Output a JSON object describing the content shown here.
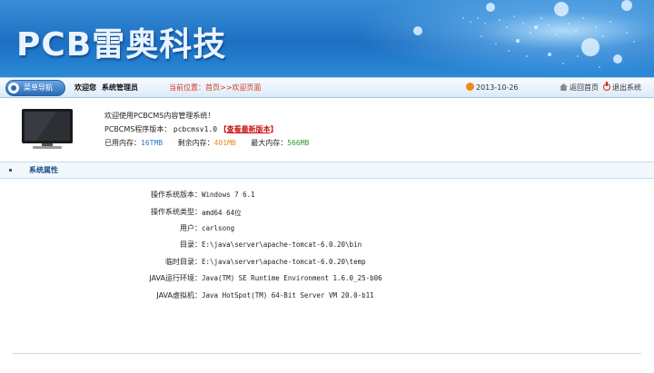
{
  "header": {
    "logo_text": "PCB雷奥科技"
  },
  "navbar": {
    "menu_button": "菜单导航",
    "welcome": "欢迎您",
    "user_role": "系统管理员",
    "breadcrumb": "当前位置：首页>>欢迎页面",
    "date": "2013-10-26",
    "home_link": "返回首页",
    "exit_link": "退出系统"
  },
  "info": {
    "welcome_msg": "欢迎使用PCBCMS内容管理系统！",
    "version_label": "PCBCMS程序版本：",
    "version_value": "pcbcmsv1.0",
    "bracket_open": "【",
    "latest_link": "查看最新版本",
    "bracket_close": "】",
    "used_mem_label": "已用内存：",
    "used_mem_value": "16TMB",
    "free_mem_label": "剩余内存：",
    "free_mem_value": "401MB",
    "max_mem_label": "最大内存：",
    "max_mem_value": "566MB"
  },
  "section": {
    "title": "系统属性"
  },
  "properties": [
    {
      "label": "操作系统版本：",
      "value": "Windows 7 6.1"
    },
    {
      "label": "操作系统类型：",
      "value": "amd64 64位"
    },
    {
      "label": "用户：",
      "value": "carlsong"
    },
    {
      "label": "目录：",
      "value": "E:\\java\\server\\apache-tomcat-6.0.20\\bin"
    },
    {
      "label": "临时目录：",
      "value": "E:\\java\\server\\apache-tomcat-6.0.20\\temp"
    },
    {
      "label": "JAVA运行环境：",
      "value": "Java(TM) SE Runtime Environment 1.6.0_25-b06"
    },
    {
      "label": "JAVA虚拟机：",
      "value": "Java HotSpot(TM) 64-Bit Server VM 20.0-b11"
    }
  ],
  "colors": {
    "banner": "#1d6fc2",
    "accent_red": "#cc1111",
    "accent_blue": "#2a78c8",
    "accent_orange": "#e68a1a",
    "accent_green": "#2e9a3a"
  },
  "icons": [
    "menu-icon",
    "clock-icon",
    "home-icon",
    "power-icon",
    "monitor-icon"
  ]
}
